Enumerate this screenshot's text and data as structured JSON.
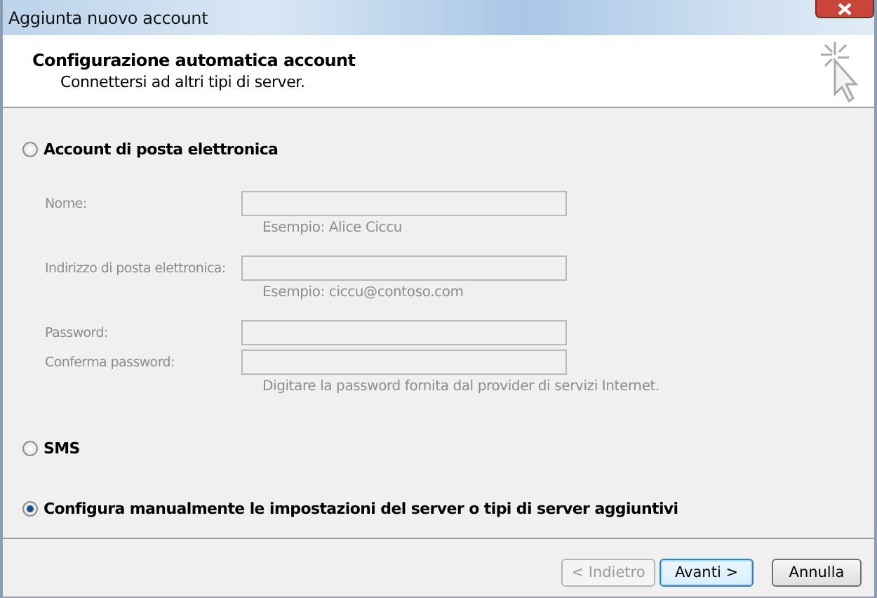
{
  "window": {
    "title": "Aggiunta nuovo account"
  },
  "header": {
    "title": "Configurazione automatica account",
    "subtitle": "Connettersi ad altri tipi di server."
  },
  "options": [
    {
      "label": "Account di posta elettronica",
      "selected": false,
      "fields": [
        {
          "label": "Nome:",
          "hint": "Esempio: Alice Ciccu",
          "disabled": true
        },
        {
          "label": "Indirizzo di posta elettronica:",
          "hint": "Esempio: ciccu@contoso.com",
          "disabled": true
        },
        {
          "label": "Password:",
          "disabled": true
        },
        {
          "label": "Conferma password:",
          "hint": "Digitare la password fornita dal provider di servizi Internet.",
          "disabled": true
        }
      ]
    },
    {
      "label": "SMS",
      "selected": false
    },
    {
      "label": "Configura manualmente le impostazioni del server o tipi di server aggiuntivi",
      "selected": true
    }
  ],
  "buttons": [
    {
      "label": "< Indietro",
      "disabled": true,
      "default": false
    },
    {
      "label": "Avanti >",
      "disabled": false,
      "default": true
    },
    {
      "label": "Annulla",
      "disabled": false,
      "default": false
    }
  ]
}
